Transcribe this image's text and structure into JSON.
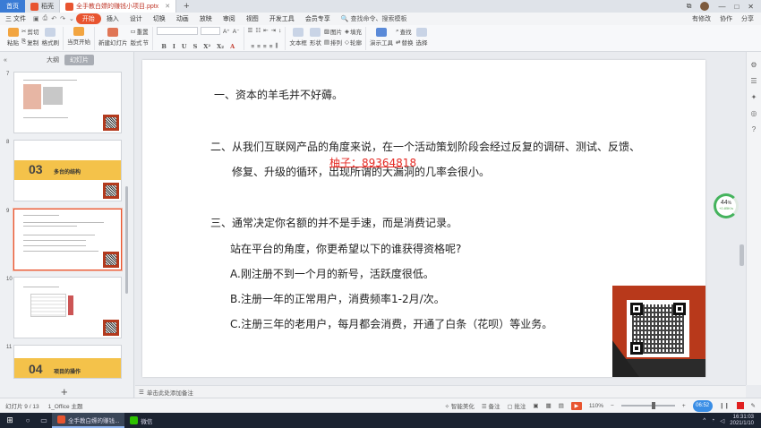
{
  "tabs": {
    "home": "首页",
    "items": [
      {
        "label": "稻壳",
        "color": "#e8542f"
      },
      {
        "label": "全手教白嫖的赚钱小项目.pptx",
        "color": "#e8542f"
      }
    ]
  },
  "window": {
    "right_icons": [
      "⧉",
      "👤",
      "—",
      "□",
      "✕"
    ]
  },
  "menu": {
    "file": "三 文件",
    "items": [
      "开始",
      "插入",
      "设计",
      "切换",
      "动画",
      "放映",
      "审阅",
      "视图",
      "开发工具",
      "会员专享"
    ],
    "active": "开始",
    "search": "查找命令、搜索模板",
    "right": [
      "有修改",
      "协作",
      "分享"
    ]
  },
  "ribbon": {
    "paste": "粘贴",
    "cut": "剪切",
    "copy": "复制",
    "format_painter": "格式刷",
    "play_from": "当页开始",
    "new_slide": "新建幻灯片",
    "layout": "版式",
    "section": "节",
    "reset": "重置",
    "format_row": [
      "B",
      "I",
      "U",
      "S",
      "X²",
      "X₂",
      "A"
    ],
    "text_box": "文本框",
    "shape": "形状",
    "arrange": "排列",
    "picture": "图片",
    "fill": "填充",
    "outline": "轮廓",
    "present_tools": "演示工具",
    "find": "查找",
    "replace": "替换",
    "select": "选择"
  },
  "left_panel": {
    "collapse": "«",
    "tab_outline": "大纲",
    "tab_slides": "幻灯片",
    "thumbs": [
      {
        "num": "7"
      },
      {
        "num": "8",
        "big": "03",
        "title": "多台的结构"
      },
      {
        "num": "9"
      },
      {
        "num": "10"
      },
      {
        "num": "11",
        "big": "04",
        "title": "项目的操作"
      }
    ],
    "add": "+"
  },
  "slide": {
    "line1": "一、资本的羊毛并不好薅。",
    "line2a": "二、从我们互联网产品的角度来说，在一个活动策划阶段会经过反复的调研、测试、反馈、",
    "line2b": "修复、升级的循环，出现所谓的大漏洞的几率会很小。",
    "watermark": "柚子：89364818",
    "line3": "三、通常决定你名额的并不是手速，而是消费记录。",
    "line4": "站在平台的角度，你更希望以下的谁获得资格呢?",
    "optA": "A.刚注册不到一个月的新号，活跃度很低。",
    "optB": "B.注册一年的正常用户，消费频率1-2月/次。",
    "optC": "C.注册三年的老用户，每月都会消费，开通了白条（花呗）等业务。"
  },
  "progress": {
    "value": 44,
    "label": "44",
    "unit": "%",
    "sub": "+0.85K/s"
  },
  "notes": {
    "placeholder": "单击此处添加备注"
  },
  "status": {
    "slide_info": "幻灯片 9 / 13",
    "theme": "1_Office 主题",
    "beautify": "智能美化",
    "notes": "备注",
    "comments": "批注",
    "zoom": "110%",
    "rec_time": "06:52"
  },
  "taskbar": {
    "apps": [
      {
        "label": "全手教白嫖的赚钱...",
        "color": "#e8542f"
      },
      {
        "label": "微信",
        "color": "#2dc100"
      }
    ],
    "time": "16:31:03",
    "date": "2021/1/10"
  },
  "colors": {
    "accent": "#e8542f",
    "qr_red": "#b8391b",
    "watermark": "#e52a24",
    "progress_green": "#45b35d"
  }
}
